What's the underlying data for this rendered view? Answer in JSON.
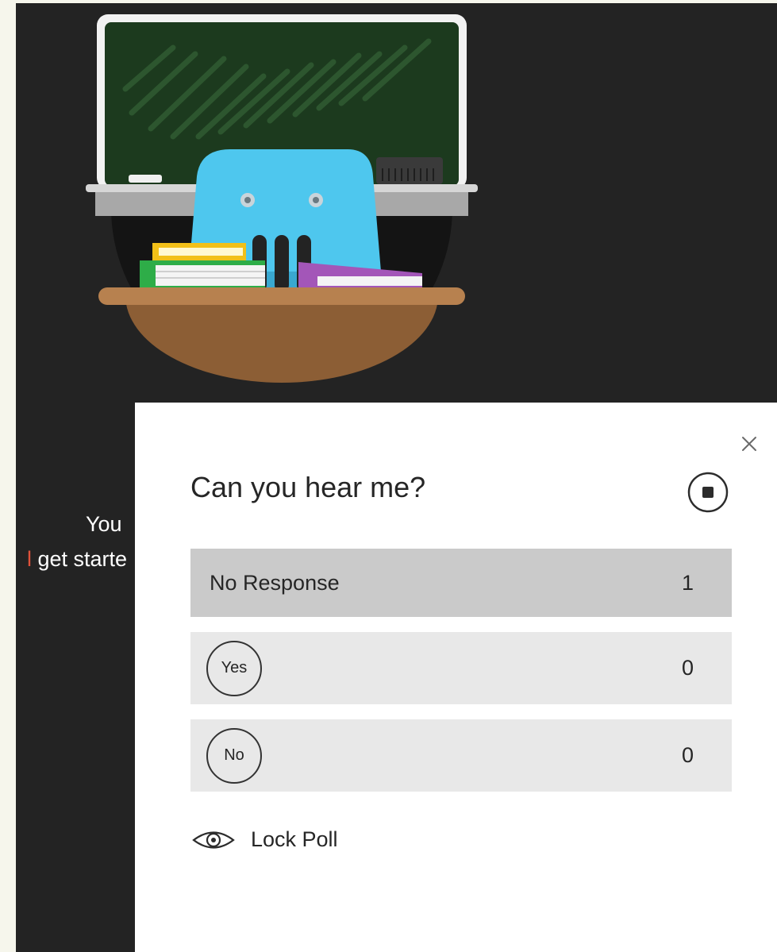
{
  "background": {
    "caption_line1": "You",
    "caption_line2_accent": "l",
    "caption_line2_rest": " get starte"
  },
  "poll": {
    "question": "Can you hear me?",
    "close_icon": "close-icon",
    "stop_icon": "stop-poll-icon",
    "no_response": {
      "label": "No Response",
      "count": "1"
    },
    "options": [
      {
        "label": "Yes",
        "count": "0"
      },
      {
        "label": "No",
        "count": "0"
      }
    ],
    "lock": {
      "label": "Lock Poll",
      "icon": "eye-icon"
    }
  },
  "colors": {
    "stage_bg": "#232323",
    "header_row_bg": "#cacaca",
    "option_row_bg": "#e8e8e8",
    "accent_text": "#e0523a"
  }
}
